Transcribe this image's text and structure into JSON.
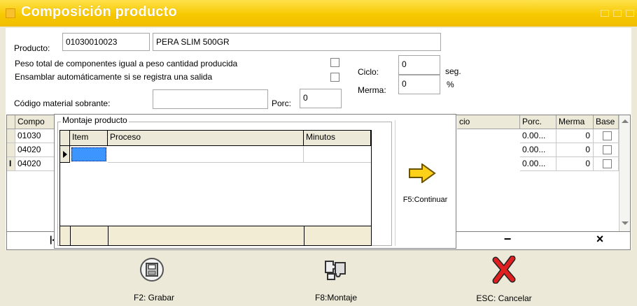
{
  "window": {
    "title": "Composición producto"
  },
  "product": {
    "label": "Producto:",
    "code": "01030010023",
    "name": "PERA SLIM 500GR"
  },
  "options": {
    "peso_total_label": "Peso total de componentes igual a peso cantidad producida",
    "ensamblar_label": "Ensamblar automáticamente si se registra una salida",
    "peso_total_checked": false,
    "ensamblar_checked": false
  },
  "ciclo": {
    "label": "Ciclo:",
    "value": "0",
    "unit": "seg."
  },
  "merma": {
    "label": "Merma:",
    "value": "0",
    "unit": "%"
  },
  "sobrante": {
    "label": "Código material sobrante:",
    "value": ""
  },
  "porc": {
    "label": "Porc:",
    "value": "0"
  },
  "components_grid": {
    "headers": {
      "comp": "Compo",
      "hidden": "cio",
      "porc": "Porc.",
      "merma": "Merma",
      "base": "Base"
    },
    "rows": [
      {
        "code": "01030",
        "porc": "0.00...",
        "merma": "0",
        "base": false
      },
      {
        "code": "04020",
        "porc": "0.00...",
        "merma": "0",
        "base": false
      },
      {
        "code": "04020",
        "porc": "0.00...",
        "merma": "0",
        "base": false
      }
    ]
  },
  "montaje": {
    "title": "Montaje producto",
    "headers": {
      "item": "Item",
      "proceso": "Proceso",
      "minutos": "Minutos"
    },
    "continue_label": "F5:Continuar"
  },
  "navigator": {
    "delete_symbol": "−",
    "cancel_symbol": "×"
  },
  "buttons": {
    "grabar": "F2: Grabar",
    "montaje": "F8:Montaje",
    "cancelar": "ESC: Cancelar"
  }
}
